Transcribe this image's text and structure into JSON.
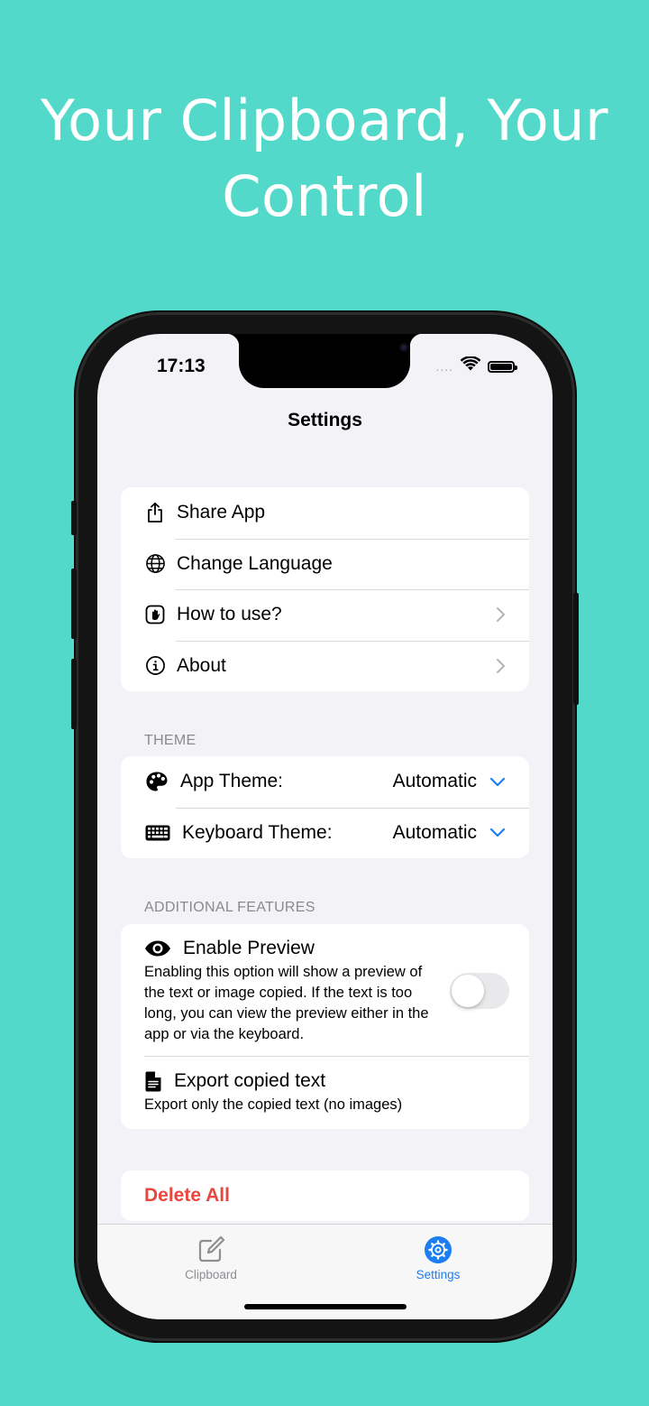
{
  "headline": {
    "line1": "Your Clipboard, Your",
    "line2": "Control"
  },
  "status_bar": {
    "time": "17:13",
    "signal": "....",
    "wifi_icon": "wifi-icon",
    "battery_icon": "battery-icon"
  },
  "nav": {
    "title": "Settings"
  },
  "general": {
    "items": [
      {
        "label": "Share App",
        "icon": "share-icon",
        "chevron": false
      },
      {
        "label": "Change Language",
        "icon": "globe-icon",
        "chevron": false
      },
      {
        "label": "How to use?",
        "icon": "hand-raised-icon",
        "chevron": true
      },
      {
        "label": "About",
        "icon": "info-icon",
        "chevron": true
      }
    ]
  },
  "theme": {
    "header": "THEME",
    "app_theme": {
      "label": "App Theme:",
      "value": "Automatic",
      "icon": "palette-icon"
    },
    "keyboard_theme": {
      "label": "Keyboard Theme:",
      "value": "Automatic",
      "icon": "keyboard-icon"
    }
  },
  "features": {
    "header": "ADDITIONAL FEATURES",
    "preview": {
      "title": "Enable Preview",
      "description": "Enabling this option will show a preview of the text or image copied. If the text is too long, you can view the preview either in the app or via the keyboard.",
      "enabled": false,
      "icon": "eye-icon"
    },
    "export": {
      "title": "Export copied text",
      "description": "Export only the copied text (no images)",
      "icon": "document-icon"
    }
  },
  "danger": {
    "delete_label": "Delete All"
  },
  "tabbar": {
    "tabs": [
      {
        "label": "Clipboard",
        "icon": "compose-icon",
        "active": false
      },
      {
        "label": "Settings",
        "icon": "gear-icon",
        "active": true
      }
    ]
  },
  "colors": {
    "background": "#52d9c9",
    "accent": "#1c7ef0",
    "destructive": "#e8473d",
    "inactive_tab": "#8e8e93"
  }
}
